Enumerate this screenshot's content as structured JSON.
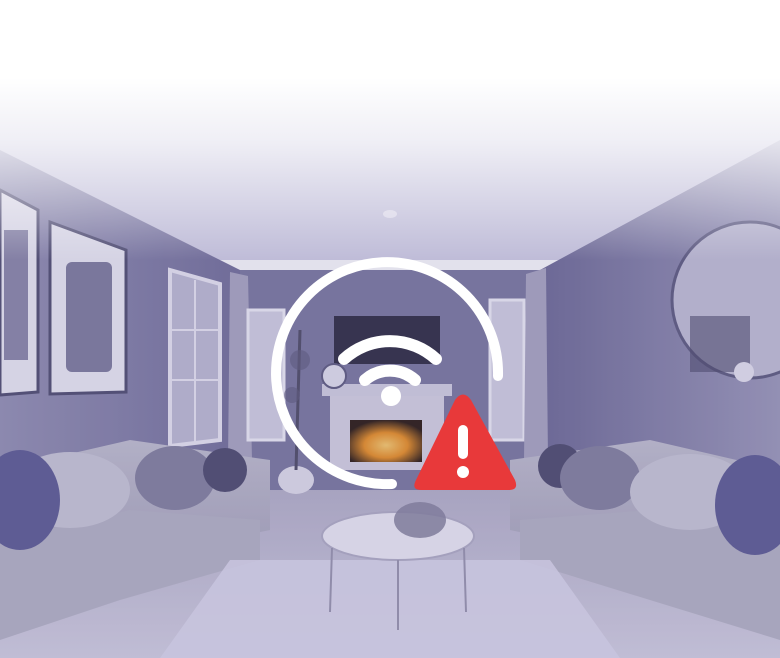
{
  "scene": {
    "description_icon": "living-room-photo",
    "palette": {
      "wall": "#8c88b0",
      "ceiling": "#dcd8ec",
      "sofa": "#b4b2c4",
      "floor": "#cfcbdc",
      "fire": "#f09a3a"
    }
  },
  "status": {
    "icon": "wifi-icon",
    "alert_icon": "warning-icon",
    "ring_color": "#ffffff",
    "alert_color": "#e8393a",
    "alert_glyph_color": "#ffffff"
  }
}
